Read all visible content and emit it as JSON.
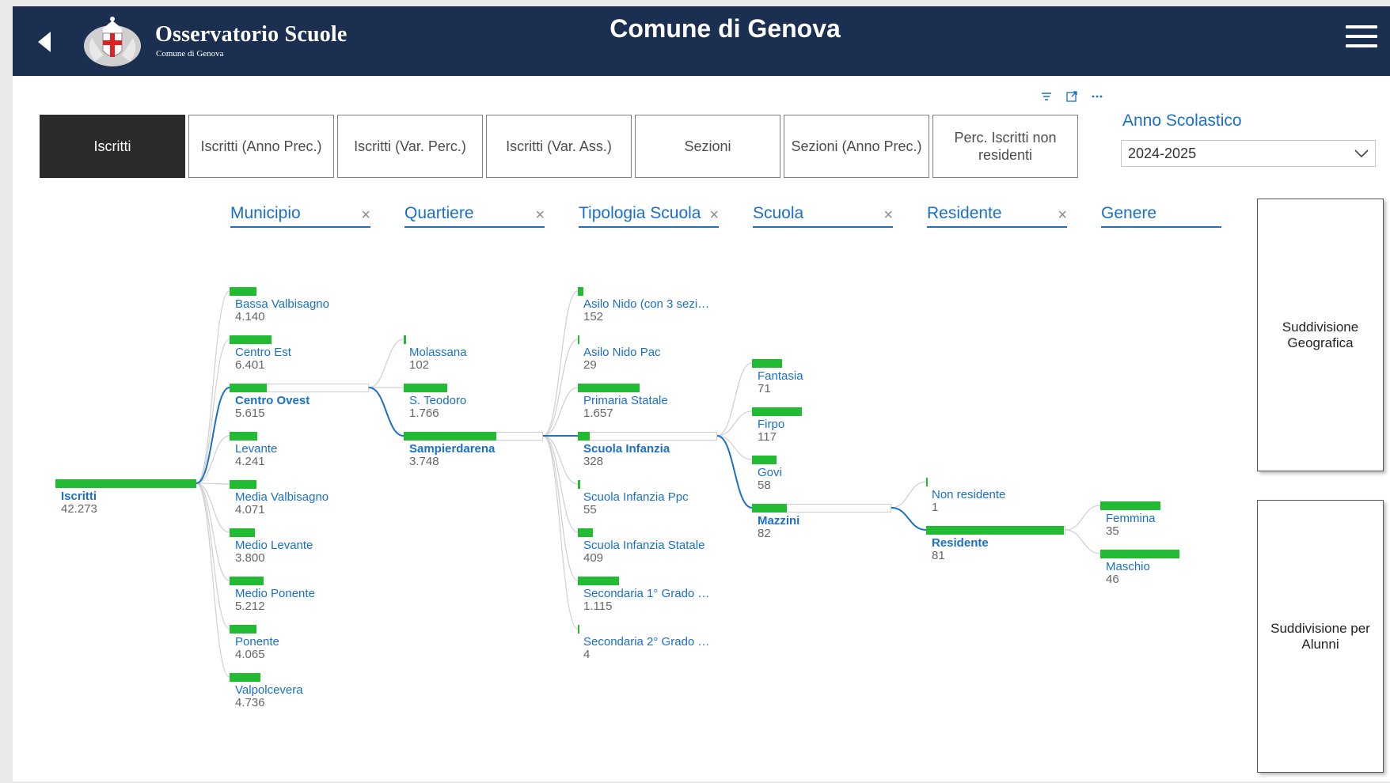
{
  "header": {
    "app_title": "Osservatorio Scuole",
    "app_subtitle": "Comune di Genova",
    "page_title": "Comune di Genova",
    "header_color": "#1b3050"
  },
  "tabs": [
    {
      "label": "Iscritti",
      "active": true
    },
    {
      "label": "Iscritti (Anno Prec.)",
      "active": false
    },
    {
      "label": "Iscritti (Var. Perc.)",
      "active": false
    },
    {
      "label": "Iscritti (Var. Ass.)",
      "active": false
    },
    {
      "label": "Sezioni",
      "active": false
    },
    {
      "label": "Sezioni (Anno Prec.)",
      "active": false
    },
    {
      "label": "Perc. Iscritti non residenti",
      "active": false
    }
  ],
  "slicer": {
    "title": "Anno Scolastico",
    "value": "2024-2025"
  },
  "levels": [
    {
      "label": "Municipio",
      "removable": true
    },
    {
      "label": "Quartiere",
      "removable": true
    },
    {
      "label": "Tipologia Scuola",
      "removable": true
    },
    {
      "label": "Scuola",
      "removable": true
    },
    {
      "label": "Residente",
      "removable": true
    },
    {
      "label": "Genere",
      "removable": false
    }
  ],
  "chart_data": {
    "type": "decomposition-tree",
    "bar_color": "#22bb33",
    "link_color": "#1a6fc9",
    "root": {
      "label": "Iscritti",
      "value": "42.273"
    },
    "columns": [
      {
        "level": "Municipio",
        "nodes": [
          {
            "label": "Bassa Valbisagno",
            "value": "4.140",
            "selected": false
          },
          {
            "label": "Centro Est",
            "value": "6.401",
            "selected": false
          },
          {
            "label": "Centro Ovest",
            "value": "5.615",
            "selected": true
          },
          {
            "label": "Levante",
            "value": "4.241",
            "selected": false
          },
          {
            "label": "Media Valbisagno",
            "value": "4.071",
            "selected": false
          },
          {
            "label": "Medio Levante",
            "value": "3.800",
            "selected": false
          },
          {
            "label": "Medio Ponente",
            "value": "5.212",
            "selected": false
          },
          {
            "label": "Ponente",
            "value": "4.065",
            "selected": false
          },
          {
            "label": "Valpolcevera",
            "value": "4.736",
            "selected": false
          }
        ]
      },
      {
        "level": "Quartiere",
        "nodes": [
          {
            "label": "Molassana",
            "value": "102",
            "selected": false
          },
          {
            "label": "S. Teodoro",
            "value": "1.766",
            "selected": false
          },
          {
            "label": "Sampierdarena",
            "value": "3.748",
            "selected": true
          }
        ]
      },
      {
        "level": "Tipologia Scuola",
        "nodes": [
          {
            "label": "Asilo Nido (con 3 sezi…",
            "value": "152",
            "selected": false
          },
          {
            "label": "Asilo Nido Pac",
            "value": "29",
            "selected": false
          },
          {
            "label": "Primaria Statale",
            "value": "1.657",
            "selected": false
          },
          {
            "label": "Scuola Infanzia",
            "value": "328",
            "selected": true
          },
          {
            "label": "Scuola Infanzia Ppc",
            "value": "55",
            "selected": false
          },
          {
            "label": "Scuola Infanzia Statale",
            "value": "409",
            "selected": false
          },
          {
            "label": "Secondaria 1° Grado …",
            "value": "1.115",
            "selected": false
          },
          {
            "label": "Secondaria 2° Grado …",
            "value": "4",
            "selected": false
          }
        ]
      },
      {
        "level": "Scuola",
        "nodes": [
          {
            "label": "Fantasia",
            "value": "71",
            "selected": false
          },
          {
            "label": "Firpo",
            "value": "117",
            "selected": false
          },
          {
            "label": "Govi",
            "value": "58",
            "selected": false
          },
          {
            "label": "Mazzini",
            "value": "82",
            "selected": true
          }
        ]
      },
      {
        "level": "Residente",
        "nodes": [
          {
            "label": "Non residente",
            "value": "1",
            "selected": false
          },
          {
            "label": "Residente",
            "value": "81",
            "selected": true
          }
        ]
      },
      {
        "level": "Genere",
        "nodes": [
          {
            "label": "Femmina",
            "value": "35",
            "selected": false
          },
          {
            "label": "Maschio",
            "value": "46",
            "selected": false
          }
        ]
      }
    ]
  },
  "side_buttons": [
    {
      "label": "Suddivisione Geografica"
    },
    {
      "label": "Suddivisione per Alunni"
    }
  ]
}
